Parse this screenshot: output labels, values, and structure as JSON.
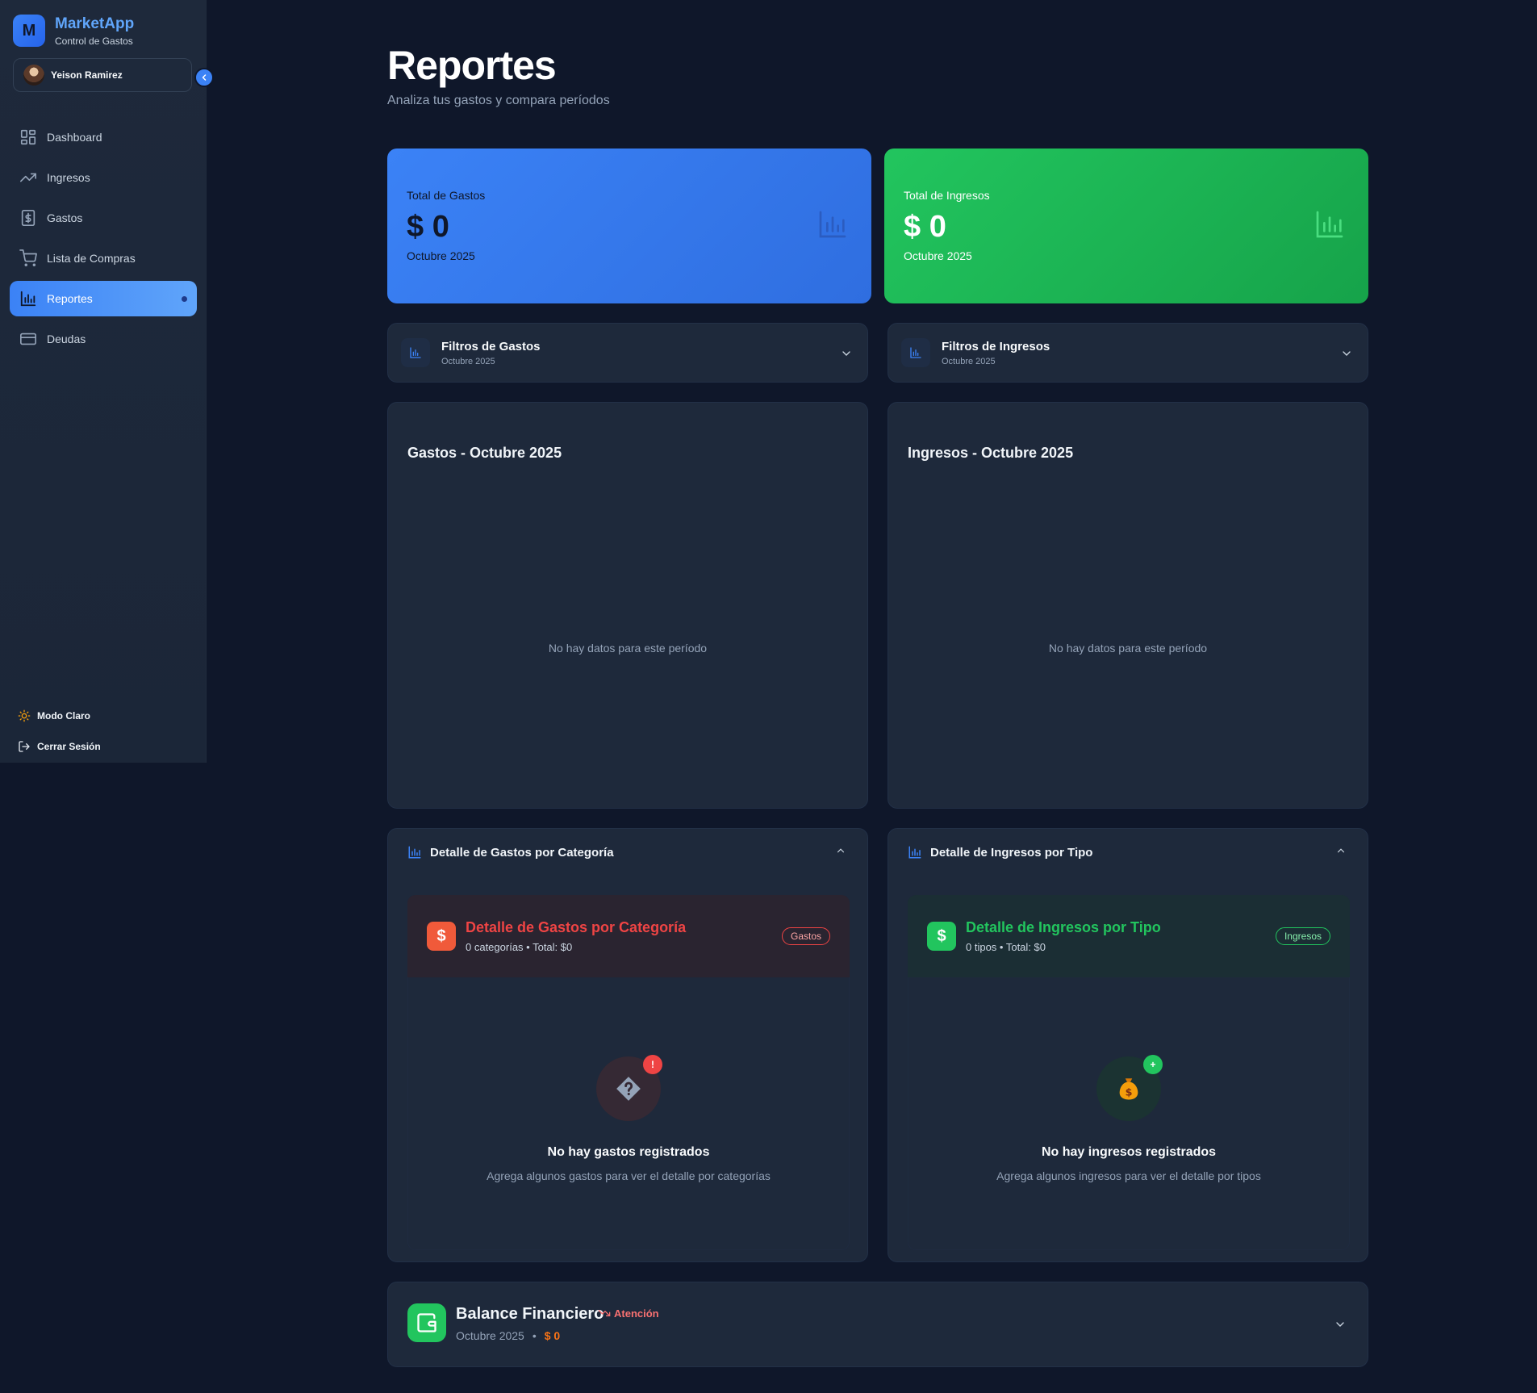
{
  "app": {
    "logo_letter": "M",
    "name": "MarketApp",
    "subtitle": "Control de Gastos"
  },
  "user": {
    "name": "Yeison Ramirez"
  },
  "nav": [
    {
      "label": "Dashboard",
      "icon": "dashboard-icon",
      "active": false
    },
    {
      "label": "Ingresos",
      "icon": "trending-up-icon",
      "active": false
    },
    {
      "label": "Gastos",
      "icon": "receipt-dollar-icon",
      "active": false
    },
    {
      "label": "Lista de Compras",
      "icon": "cart-icon",
      "active": false
    },
    {
      "label": "Reportes",
      "icon": "bar-chart-icon",
      "active": true
    },
    {
      "label": "Deudas",
      "icon": "credit-card-icon",
      "active": false
    }
  ],
  "sidebar_bottom": {
    "theme_label": "Modo Claro",
    "logout_label": "Cerrar Sesión"
  },
  "page": {
    "title": "Reportes",
    "subtitle": "Analiza tus gastos y compara períodos"
  },
  "kpis": {
    "expenses": {
      "label": "Total de Gastos",
      "value": "$ 0",
      "period": "Octubre 2025",
      "color": "#3b82f6"
    },
    "income": {
      "label": "Total de Ingresos",
      "value": "$ 0",
      "period": "Octubre 2025",
      "color": "#22c55e"
    }
  },
  "filters": {
    "expenses": {
      "title": "Filtros de Gastos",
      "period": "Octubre 2025"
    },
    "income": {
      "title": "Filtros de Ingresos",
      "period": "Octubre 2025"
    }
  },
  "charts": {
    "expenses": {
      "title": "Gastos - Octubre 2025",
      "empty": "No hay datos para este período"
    },
    "income": {
      "title": "Ingresos - Octubre 2025",
      "empty": "No hay datos para este período"
    }
  },
  "details": {
    "expenses": {
      "section_title": "Detalle de Gastos por Categoría",
      "title": "Detalle de Gastos por Categoría",
      "summary": "0 categorías • Total: $0",
      "badge": "Gastos",
      "symbol": "$",
      "empty_badge": "!",
      "empty_title": "No hay gastos registrados",
      "empty_sub": "Agrega algunos gastos para ver el detalle por categorías"
    },
    "income": {
      "section_title": "Detalle de Ingresos por Tipo",
      "title": "Detalle de Ingresos por Tipo",
      "summary": "0 tipos • Total: $0",
      "badge": "Ingresos",
      "symbol": "$",
      "empty_badge": "+",
      "empty_title": "No hay ingresos registrados",
      "empty_sub": "Agrega algunos ingresos para ver el detalle por tipos"
    }
  },
  "balance": {
    "title": "Balance Financiero",
    "alert": "Atención",
    "period": "Octubre 2025",
    "separator": "•",
    "amount": "$ 0"
  }
}
